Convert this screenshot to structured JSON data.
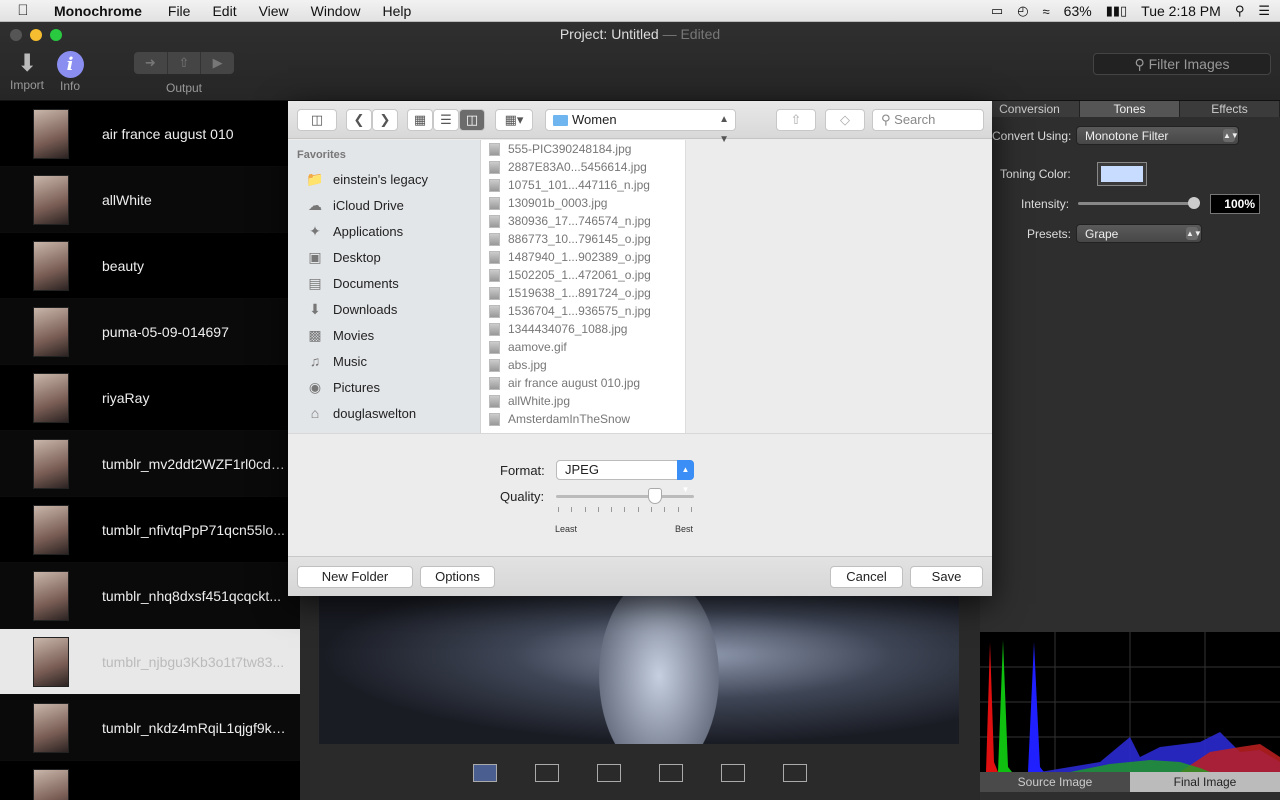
{
  "menubar": {
    "app_name": "Monochrome",
    "items": [
      "File",
      "Edit",
      "View",
      "Window",
      "Help"
    ],
    "battery": "63%",
    "clock": "Tue 2:18 PM"
  },
  "window": {
    "title_prefix": "Project:",
    "title_name": "Untitled",
    "title_status": "— Edited"
  },
  "toolbar": {
    "import_label": "Import",
    "info_label": "Info",
    "output_label": "Output",
    "filter_placeholder": "Filter Images"
  },
  "sidebar": {
    "items": [
      "air france august 010",
      "allWhite",
      "beauty",
      "puma-05-09-014697",
      "riyaRay",
      "tumblr_mv2ddt2WZF1rl0cds...",
      "tumblr_nfivtqPpP71qcn55lo...",
      "tumblr_nhq8dxsf451qcqckt...",
      "tumblr_njbgu3Kb3o1t7tw83...",
      "tumblr_nkdz4mRqiL1qjgf9ko...",
      ""
    ]
  },
  "right_panel": {
    "tabs": [
      "Conversion",
      "Tones",
      "Effects"
    ],
    "convert_label": "Convert Using:",
    "convert_value": "Monotone Filter",
    "toning_label": "Toning Color:",
    "intensity_label": "Intensity:",
    "intensity_value": "100%",
    "intensity_level": 1.0,
    "presets_label": "Presets:",
    "presets_value": "Grape",
    "histogram_tabs": [
      "Source Image",
      "Final Image"
    ],
    "toning_color": "#c8dcff"
  },
  "dialog": {
    "folder": "Women",
    "search_placeholder": "Search",
    "favorites_header": "Favorites",
    "favorites": [
      {
        "label": "einstein's legacy",
        "icon": "folder-icon"
      },
      {
        "label": "iCloud Drive",
        "icon": "cloud-icon"
      },
      {
        "label": "Applications",
        "icon": "applications-icon"
      },
      {
        "label": "Desktop",
        "icon": "desktop-icon"
      },
      {
        "label": "Documents",
        "icon": "documents-icon"
      },
      {
        "label": "Downloads",
        "icon": "downloads-icon"
      },
      {
        "label": "Movies",
        "icon": "movies-icon"
      },
      {
        "label": "Music",
        "icon": "music-icon"
      },
      {
        "label": "Pictures",
        "icon": "pictures-icon"
      },
      {
        "label": "douglaswelton",
        "icon": "home-icon"
      }
    ],
    "files": [
      "555-PIC390248184.jpg",
      "2887E83A0...5456614.jpg",
      "10751_101...447116_n.jpg",
      "130901b_0003.jpg",
      "380936_17...746574_n.jpg",
      "886773_10...796145_o.jpg",
      "1487940_1...902389_o.jpg",
      "1502205_1...472061_o.jpg",
      "1519638_1...891724_o.jpg",
      "1536704_1...936575_n.jpg",
      "1344434076_1088.jpg",
      "aamove.gif",
      "abs.jpg",
      "air france august 010.jpg",
      "allWhite.jpg",
      "AmsterdamInTheSnow"
    ],
    "format_label": "Format:",
    "format_value": "JPEG",
    "quality_label": "Quality:",
    "quality_level": 0.8,
    "quality_min": "Least",
    "quality_max": "Best",
    "new_folder": "New Folder",
    "options": "Options",
    "cancel": "Cancel",
    "save": "Save"
  }
}
